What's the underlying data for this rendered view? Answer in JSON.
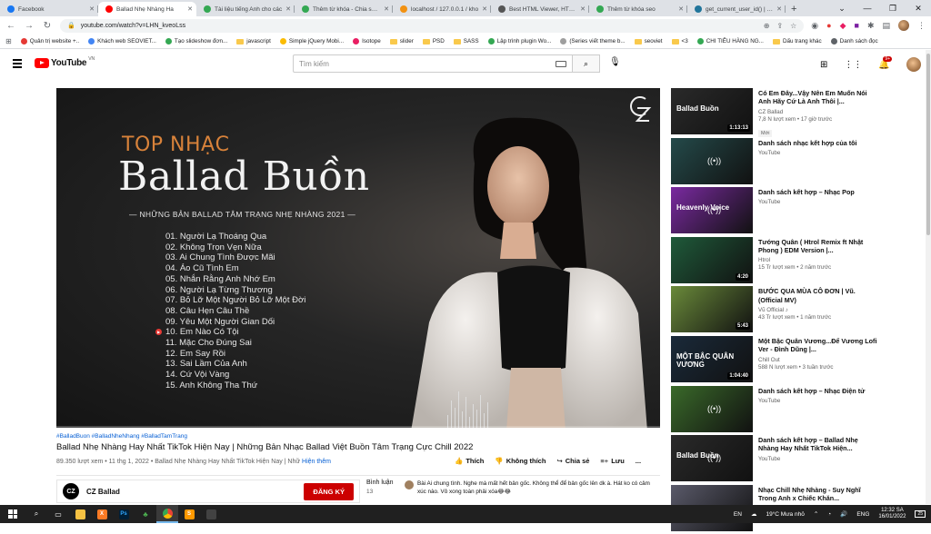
{
  "browser": {
    "tabs": [
      {
        "label": "Facebook",
        "color": "#1877f2",
        "active": false
      },
      {
        "label": "Ballad Nhẹ Nhàng Ha",
        "color": "#ff0000",
        "active": true
      },
      {
        "label": "Tài liệu tiếng Anh cho các",
        "color": "#34a853",
        "active": false
      },
      {
        "label": "Thêm từ khóa - Chia sẻ m",
        "color": "#34a853",
        "active": false
      },
      {
        "label": "localhost / 127.0.0.1 / kho",
        "color": "#f29111",
        "active": false
      },
      {
        "label": "Best HTML Viewer, HTML B",
        "color": "#555555",
        "active": false
      },
      {
        "label": "Thêm từ khóa seo",
        "color": "#34a853",
        "active": false
      },
      {
        "label": "get_current_user_id() | Fun",
        "color": "#21759b",
        "active": false
      }
    ],
    "url": "youtube.com/watch?v=LHN_kveoLss",
    "bookmarks": [
      {
        "label": "Quản trị website +..",
        "kind": "icon",
        "color": "#e53935"
      },
      {
        "label": "Khách web SEOVIET...",
        "kind": "icon",
        "color": "#4285f4"
      },
      {
        "label": "Tạo slideshow đơn...",
        "kind": "icon",
        "color": "#34a853"
      },
      {
        "label": "javascript",
        "kind": "folder"
      },
      {
        "label": "Simple jQuery Mobi...",
        "kind": "icon",
        "color": "#fbbc04"
      },
      {
        "label": "Isotope",
        "kind": "icon",
        "color": "#e91e63"
      },
      {
        "label": "slider",
        "kind": "folder"
      },
      {
        "label": "PSD",
        "kind": "folder"
      },
      {
        "label": "SASS",
        "kind": "folder"
      },
      {
        "label": "Lập trình plugin Wo...",
        "kind": "icon",
        "color": "#34a853"
      },
      {
        "label": "(Series viết theme b...",
        "kind": "icon",
        "color": "#9e9e9e"
      },
      {
        "label": "seoviet",
        "kind": "folder"
      },
      {
        "label": "<3",
        "kind": "folder"
      },
      {
        "label": "CHI TIÊU HÀNG NG...",
        "kind": "icon",
        "color": "#34a853"
      },
      {
        "label": "Dấu trang khác",
        "kind": "folder"
      },
      {
        "label": "Danh sách đọc",
        "kind": "icon",
        "color": "#5f6368"
      }
    ]
  },
  "youtube": {
    "logo_text": "YouTube",
    "country": "VN",
    "search_placeholder": "Tìm kiếm",
    "notif_count": "9+"
  },
  "video": {
    "thumb_top": "TOP NHẠC",
    "thumb_big": "Ballad Buồn",
    "thumb_sub": "— NHỮNG BẢN BALLAD TÂM TRẠNG NHẸ NHÀNG 2021 —",
    "tracks": [
      "01. Người Lạ Thoáng Qua",
      "02. Không Trọn Vẹn Nữa",
      "03. Ai Chung Tình Được Mãi",
      "04. Áo Cũ Tình Em",
      "05. Nhắn Rằng Anh Nhớ Em",
      "06. Người Lạ Từng Thương",
      "07. Bỏ Lỡ Một Người Bỏ Lỡ Một Đời",
      "08. Câu Hẹn Câu Thề",
      "09. Yêu Một Người Gian Dối",
      "10. Em Nào Có Tội",
      "11. Mặc Cho Đúng Sai",
      "12. Em Say Rồi",
      "13. Sai Lầm Của Anh",
      "14. Cứ Vội Vàng",
      "15. Anh Không Tha Thứ"
    ],
    "playing_index": 9,
    "progress": 0,
    "watermark": "CZ",
    "hashtags": "#BalladBuon #BalladNheNhang #BalladTamTrang",
    "title": "Ballad Nhẹ Nhàng Hay Nhất TikTok Hiện Nay | Những Bản Nhạc Ballad Việt Buồn Tâm Trạng Cực Chill 2022",
    "views": "89.350 lượt xem",
    "date": "11 thg 1, 2022",
    "desc_snippet": "Ballad Nhẹ Nhàng Hay Nhất TikTok Hiện Nay | Nhữ",
    "more_label": "Hiện thêm",
    "like_label": "Thích",
    "dislike_label": "Không thích",
    "share_label": "Chia sẻ",
    "save_label": "Lưu",
    "more_actions": "..."
  },
  "channel": {
    "avatar_text": "CZ",
    "name": "CZ Ballad",
    "subscribe_label": "ĐĂNG KÝ"
  },
  "comments": {
    "heading": "Bình luận",
    "count": "13",
    "top_comment": "Bài Ai chung tình. Nghe mà mất hết bản gốc. Không thể để bản gốc lên dk à. Hát ko có cảm xúc nào. Vô xong toàn phải xóa😂😂"
  },
  "related": [
    {
      "title": "Có Em Đây...Vậy Nên Em Muốn Nói Anh Hãy Cứ Là Anh Thôi |...",
      "channel": "CZ Ballad",
      "meta": "7,8 N lượt xem • 17 giờ trước",
      "duration": "1:13:13",
      "badge": "Mới",
      "mix": false,
      "bg": "#2a2a2a",
      "overlay": "Ballad Buồn"
    },
    {
      "title": "Danh sách nhạc kết hợp của tôi",
      "channel": "YouTube",
      "meta": "",
      "duration": "",
      "badge": "",
      "mix": true,
      "bg": "#244a4a",
      "overlay": ""
    },
    {
      "title": "Danh sách kết hợp – Nhạc Pop",
      "channel": "YouTube",
      "meta": "",
      "duration": "",
      "badge": "",
      "mix": true,
      "bg": "#7a2aa0",
      "overlay": "Heavenly Voice"
    },
    {
      "title": "Tướng Quân ( Htrol Remix ft Nhật Phong ) EDM Version |...",
      "channel": "Htrol",
      "meta": "15 Tr lượt xem • 2 năm trước",
      "duration": "4:20",
      "badge": "",
      "mix": false,
      "bg": "#1f5a3a",
      "overlay": ""
    },
    {
      "title": "BƯỚC QUA MÙA CÔ ĐƠN | Vũ. (Official MV)",
      "channel": "Vũ Official ♪",
      "meta": "43 Tr lượt xem • 1 năm trước",
      "duration": "5:43",
      "badge": "",
      "mix": false,
      "bg": "#6a8a3a",
      "overlay": ""
    },
    {
      "title": "Một Bậc Quân Vương...Để Vương Lofi Ver - Đình Dũng |...",
      "channel": "Chill Out",
      "meta": "588 N lượt xem • 3 tuần trước",
      "duration": "1:04:40",
      "badge": "",
      "mix": false,
      "bg": "#1a2a3a",
      "overlay": "MỘT BẬC QUÂN VƯƠNG"
    },
    {
      "title": "Danh sách kết hợp – Nhạc Điện tử",
      "channel": "YouTube",
      "meta": "",
      "duration": "",
      "badge": "",
      "mix": true,
      "bg": "#3a6a2a",
      "overlay": ""
    },
    {
      "title": "Danh sách kết hợp – Ballad Nhẹ Nhàng Hay Nhất TikTok Hiện...",
      "channel": "YouTube",
      "meta": "",
      "duration": "",
      "badge": "",
      "mix": true,
      "bg": "#2a2a2a",
      "overlay": "Ballad Buồn"
    },
    {
      "title": "Nhạc Chill Nhẹ Nhàng - Suy Nghĩ Trong Anh x Chiếc Khăn...",
      "channel": "",
      "meta": "",
      "duration": "",
      "badge": "",
      "mix": false,
      "bg": "#5a5a6a",
      "overlay": ""
    }
  ],
  "taskbar": {
    "lang": "EN",
    "weather": "19°C  Mưa nhỏ",
    "ime": "ENG",
    "time": "12:32 SA",
    "date": "16/01/2022",
    "notif": "25"
  }
}
